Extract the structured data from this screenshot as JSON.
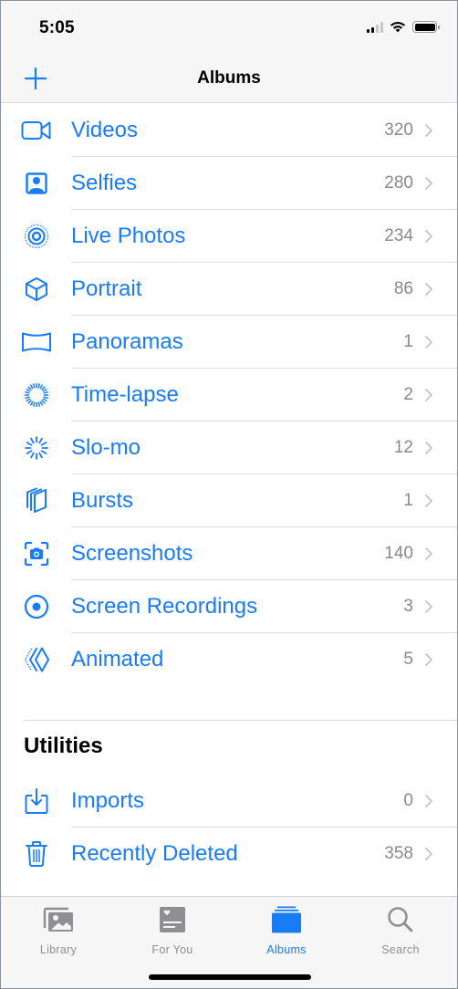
{
  "status_bar": {
    "time": "5:05",
    "signal_bars_active": 2,
    "signal_bars_total": 4,
    "wifi_icon": "wifi-icon",
    "battery_level": 1.0
  },
  "nav": {
    "title": "Albums",
    "add_icon": "plus-icon"
  },
  "colors": {
    "accent": "#1a7cf5",
    "count_gray": "#8a8a8e",
    "separator": "#dedede",
    "bar_background": "#f6f6f6",
    "tab_inactive": "#8e8e93"
  },
  "media_types": [
    {
      "label": "Videos",
      "count": "320",
      "icon": "video-camera-icon"
    },
    {
      "label": "Selfies",
      "count": "280",
      "icon": "selfie-portrait-icon"
    },
    {
      "label": "Live Photos",
      "count": "234",
      "icon": "live-photo-icon"
    },
    {
      "label": "Portrait",
      "count": "86",
      "icon": "cube-icon"
    },
    {
      "label": "Panoramas",
      "count": "1",
      "icon": "panorama-icon"
    },
    {
      "label": "Time-lapse",
      "count": "2",
      "icon": "timelapse-icon"
    },
    {
      "label": "Slo-mo",
      "count": "12",
      "icon": "slomo-icon"
    },
    {
      "label": "Bursts",
      "count": "1",
      "icon": "bursts-icon"
    },
    {
      "label": "Screenshots",
      "count": "140",
      "icon": "screenshot-camera-icon"
    },
    {
      "label": "Screen Recordings",
      "count": "3",
      "icon": "screen-recording-icon"
    },
    {
      "label": "Animated",
      "count": "5",
      "icon": "animated-icon"
    }
  ],
  "utilities": {
    "title": "Utilities",
    "items": [
      {
        "label": "Imports",
        "count": "0",
        "icon": "import-tray-icon"
      },
      {
        "label": "Recently Deleted",
        "count": "358",
        "icon": "trash-icon"
      }
    ]
  },
  "tab_bar": {
    "tabs": [
      {
        "label": "Library",
        "icon": "photo-library-icon",
        "active": false
      },
      {
        "label": "For You",
        "icon": "for-you-icon",
        "active": false
      },
      {
        "label": "Albums",
        "icon": "albums-stack-icon",
        "active": true
      },
      {
        "label": "Search",
        "icon": "magnifying-glass-icon",
        "active": false
      }
    ]
  }
}
